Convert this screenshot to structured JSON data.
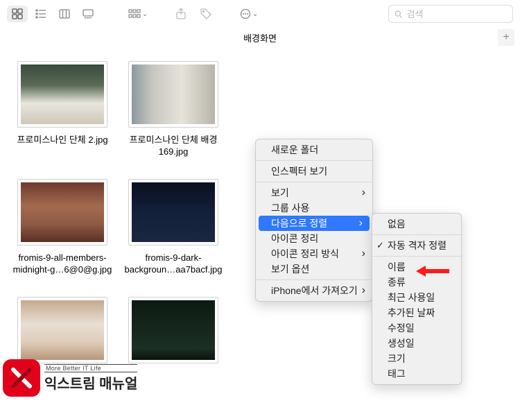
{
  "window": {
    "title": "배경화면"
  },
  "search": {
    "placeholder": "검색"
  },
  "files": [
    {
      "label": "프로미스나인 단체 2.jpg",
      "bg": "linear-gradient(180deg,#3a4a3f 0%,#5b6b55 35%,#e8e6de 65%,#cfc8b8 100%)"
    },
    {
      "label": "프로미스나인 단체 배경 169.jpg",
      "bg": "linear-gradient(90deg,#8a9aa2 0%,#c7c6bf 25%,#e6e3da 60%,#b7b4aa 100%)"
    },
    {
      "label": "fromis-9-all-members-midnight-g…6@0@g.jpg",
      "bg": "linear-gradient(180deg,#6d3a2f 0%,#a46a4f 40%,#8e5a44 70%,#5a2f25 100%)"
    },
    {
      "label": "fromis-9-dark-backgroun…aa7bacf.jpg",
      "bg": "linear-gradient(180deg,#0a1020 0%,#12203a 50%,#1a2740 100%)"
    },
    {
      "label": "",
      "bg": "linear-gradient(180deg,#c6a98f 0%,#e7dfd3 40%,#dfcdbb 70%,#b8977a 100%)"
    },
    {
      "label": "",
      "bg": "linear-gradient(180deg,#0c1a12 0%,#15261c 45%,#1b3024 80%,#0a140e 100%)"
    }
  ],
  "context_menu": {
    "items": [
      {
        "label": "새로운 폴더",
        "sub": false
      },
      {
        "sep": true
      },
      {
        "label": "인스펙터 보기",
        "sub": false
      },
      {
        "sep": true
      },
      {
        "label": "보기",
        "sub": true
      },
      {
        "label": "그룹 사용",
        "sub": false
      },
      {
        "label": "다음으로 정렬",
        "sub": true,
        "highlight": true
      },
      {
        "label": "아이콘 정리",
        "sub": false
      },
      {
        "label": "아이콘 정리 방식",
        "sub": true
      },
      {
        "label": "보기 옵션",
        "sub": false
      },
      {
        "sep": true
      },
      {
        "label": "iPhone에서 가져오기",
        "sub": true
      }
    ]
  },
  "sort_submenu": {
    "items": [
      {
        "label": "없음"
      },
      {
        "sep": true
      },
      {
        "label": "자동 격자 정렬",
        "checked": true
      },
      {
        "sep": true
      },
      {
        "label": "이름"
      },
      {
        "label": "종류"
      },
      {
        "label": "최근 사용일"
      },
      {
        "label": "추가된 날짜"
      },
      {
        "label": "수정일"
      },
      {
        "label": "생성일"
      },
      {
        "label": "크기"
      },
      {
        "label": "태그"
      }
    ]
  },
  "watermark": {
    "sub": "More Better IT Life",
    "main": "익스트림 매뉴얼",
    "badge": "ex"
  }
}
